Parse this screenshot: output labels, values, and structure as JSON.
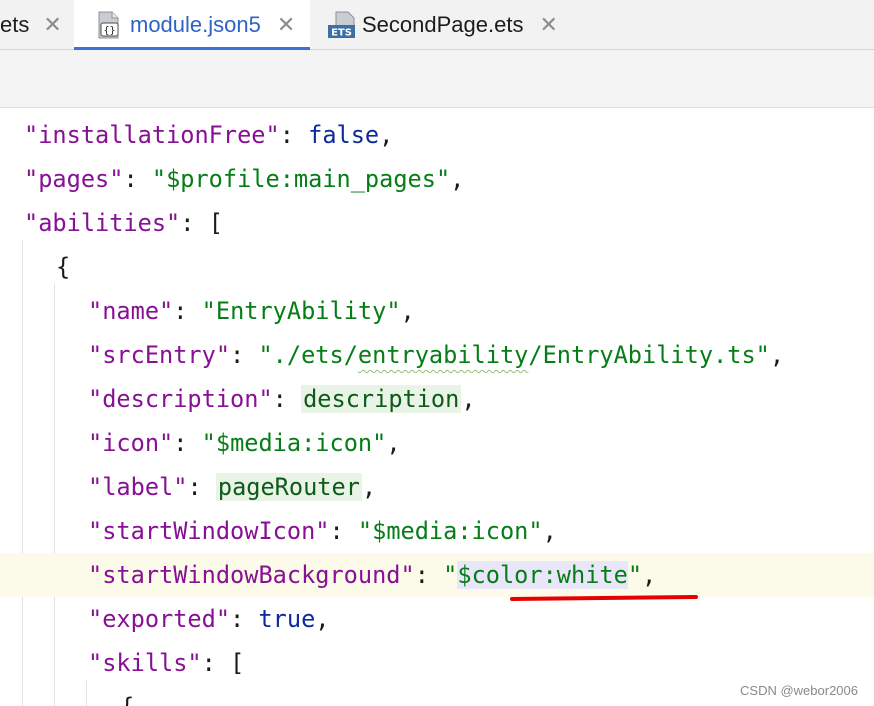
{
  "tabs": [
    {
      "label": "ets",
      "icon": "file-icon",
      "active": false
    },
    {
      "label": "module.json5",
      "icon": "json5-file-icon",
      "active": true
    },
    {
      "label": "SecondPage.ets",
      "icon": "ets-file-icon",
      "active": false
    }
  ],
  "tab_close_glyph": "✕",
  "ets_badge": "ETS",
  "json_badge": "{}",
  "editor": {
    "lines": [
      {
        "key": "\"installationFree\"",
        "sep": ": ",
        "val": "false",
        "end": ","
      },
      {
        "key": "\"pages\"",
        "sep": ": ",
        "val": "\"$profile:main_pages\"",
        "end": ","
      },
      {
        "key": "\"abilities\"",
        "sep": ": ",
        "val": "[",
        "end": ""
      },
      {
        "text": "{"
      },
      {
        "key": "\"name\"",
        "sep": ": ",
        "val": "\"EntryAbility\"",
        "end": ","
      },
      {
        "key": "\"srcEntry\"",
        "sep": ": ",
        "val_pre": "\"./ets/",
        "val_wavy": "entryability",
        "val_post": "/EntryAbility.ts\"",
        "end": ","
      },
      {
        "key": "\"description\"",
        "sep": ": ",
        "val": "description",
        "end": ","
      },
      {
        "key": "\"icon\"",
        "sep": ": ",
        "val": "\"$media:icon\"",
        "end": ","
      },
      {
        "key": "\"label\"",
        "sep": ": ",
        "val": "pageRouter",
        "end": ","
      },
      {
        "key": "\"startWindowIcon\"",
        "sep": ": ",
        "val": "\"$media:icon\"",
        "end": ","
      },
      {
        "key": "\"startWindowBackground\"",
        "sep": ": ",
        "q1": "\"",
        "val": "$color:white",
        "q2": "\"",
        "end": ","
      },
      {
        "key": "\"exported\"",
        "sep": ": ",
        "val": "true",
        "end": ","
      },
      {
        "key": "\"skills\"",
        "sep": ": ",
        "val": "[",
        "end": ""
      },
      {
        "text": "{"
      }
    ]
  },
  "watermark": "CSDN @webor2006",
  "colors": {
    "key": "#871094",
    "string": "#067d17",
    "keyword": "#0b2b9c",
    "active_tab": "#2d63c8",
    "annotation": "#e60000"
  }
}
